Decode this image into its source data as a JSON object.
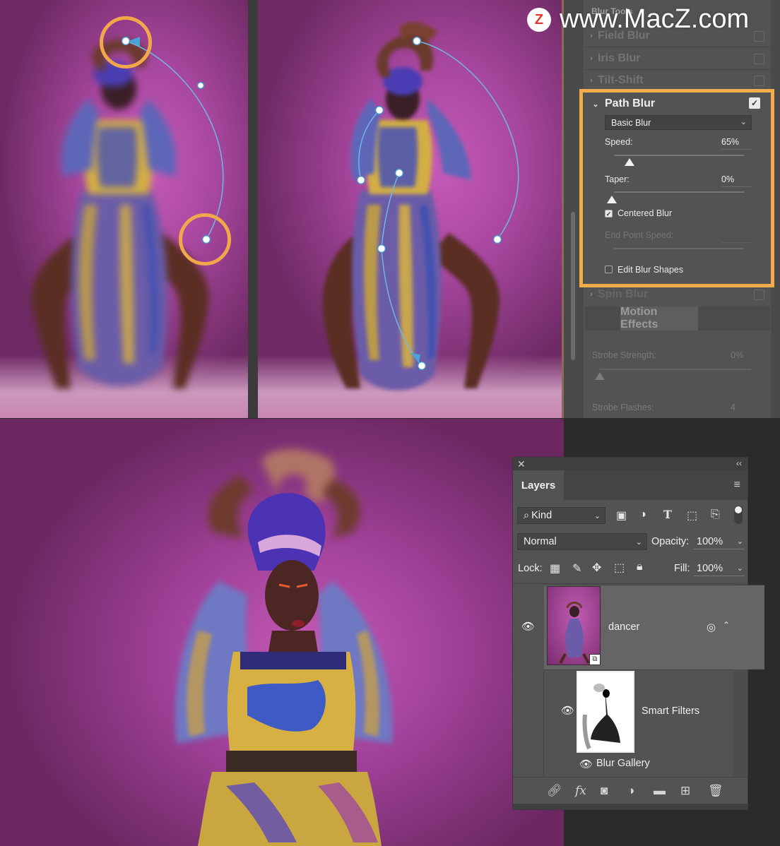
{
  "watermark": {
    "logo_letter": "Z",
    "text": "www.MacZ.com"
  },
  "blur_tools": {
    "title": "Blur Tools",
    "sections": [
      {
        "label": "Field Blur",
        "checked": false
      },
      {
        "label": "Iris Blur",
        "checked": false
      },
      {
        "label": "Tilt-Shift",
        "checked": false
      }
    ],
    "path_blur": {
      "label": "Path Blur",
      "checked": true,
      "mode": "Basic Blur",
      "speed_label": "Speed:",
      "speed_value": "65%",
      "speed_level": 0.65,
      "taper_label": "Taper:",
      "taper_value": "0%",
      "taper_level": 0,
      "centered_blur_label": "Centered Blur",
      "centered_blur_checked": true,
      "end_point_speed_label": "End Point Speed:",
      "edit_blur_shapes_label": "Edit Blur Shapes",
      "edit_blur_shapes_checked": false
    },
    "spin_blur_label": "Spin Blur",
    "motion_effects_tab": "Motion Effects",
    "strobe_strength_label": "Strobe Strength:",
    "strobe_strength_value": "0%",
    "strobe_flashes_label": "Strobe Flashes:",
    "strobe_flashes_value": "4",
    "highlight_color": "#f2ad4a"
  },
  "layers_panel": {
    "tab_label": "Layers",
    "filter_kind": "Kind",
    "blend_mode": "Normal",
    "opacity_label": "Opacity:",
    "opacity_value": "100%",
    "lock_label": "Lock:",
    "fill_label": "Fill:",
    "fill_value": "100%",
    "layers": [
      {
        "name": "dancer",
        "visible": true
      },
      {
        "name": "Smart Filters",
        "visible": true
      },
      {
        "name": "Blur Gallery",
        "visible": true
      }
    ],
    "icons": {
      "close": "close-icon",
      "collapse": "collapse-icon",
      "menu": "panel-menu-icon",
      "search": "search-icon",
      "footer": [
        "link-layers-icon",
        "fx-icon",
        "add-mask-icon",
        "adjustment-layer-icon",
        "new-group-icon",
        "new-layer-icon",
        "delete-icon"
      ]
    }
  }
}
